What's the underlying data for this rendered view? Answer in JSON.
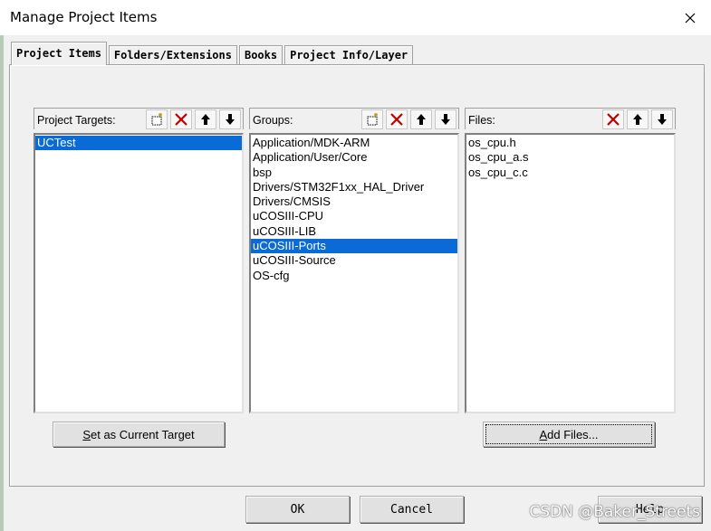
{
  "window": {
    "title": "Manage Project Items"
  },
  "tabs": [
    {
      "label": "Project Items",
      "active": true
    },
    {
      "label": "Folders/Extensions",
      "active": false
    },
    {
      "label": "Books",
      "active": false
    },
    {
      "label": "Project Info/Layer",
      "active": false
    }
  ],
  "targets": {
    "header": "Project Targets:",
    "items": [
      {
        "label": "UCTest",
        "selected": true
      }
    ]
  },
  "groups": {
    "header": "Groups:",
    "items": [
      {
        "label": "Application/MDK-ARM",
        "selected": false
      },
      {
        "label": "Application/User/Core",
        "selected": false
      },
      {
        "label": "bsp",
        "selected": false
      },
      {
        "label": "Drivers/STM32F1xx_HAL_Driver",
        "selected": false
      },
      {
        "label": "Drivers/CMSIS",
        "selected": false
      },
      {
        "label": "uCOSIII-CPU",
        "selected": false
      },
      {
        "label": "uCOSIII-LIB",
        "selected": false
      },
      {
        "label": "uCOSIII-Ports",
        "selected": true
      },
      {
        "label": "uCOSIII-Source",
        "selected": false
      },
      {
        "label": "OS-cfg",
        "selected": false
      }
    ]
  },
  "files": {
    "header": "Files:",
    "items": [
      {
        "label": "os_cpu.h",
        "selected": false
      },
      {
        "label": "os_cpu_a.s",
        "selected": false
      },
      {
        "label": "os_cpu_c.c",
        "selected": false
      }
    ]
  },
  "buttons": {
    "set_target_accel": "S",
    "set_target_rest": "et as Current Target",
    "add_files_accel": "A",
    "add_files_rest": "dd Files...",
    "ok": "OK",
    "cancel": "Cancel",
    "help": "Help"
  },
  "watermark": "CSDN @Baker_Streets",
  "colors": {
    "selection": "#0a6ad6",
    "delete_icon": "#c00000"
  }
}
